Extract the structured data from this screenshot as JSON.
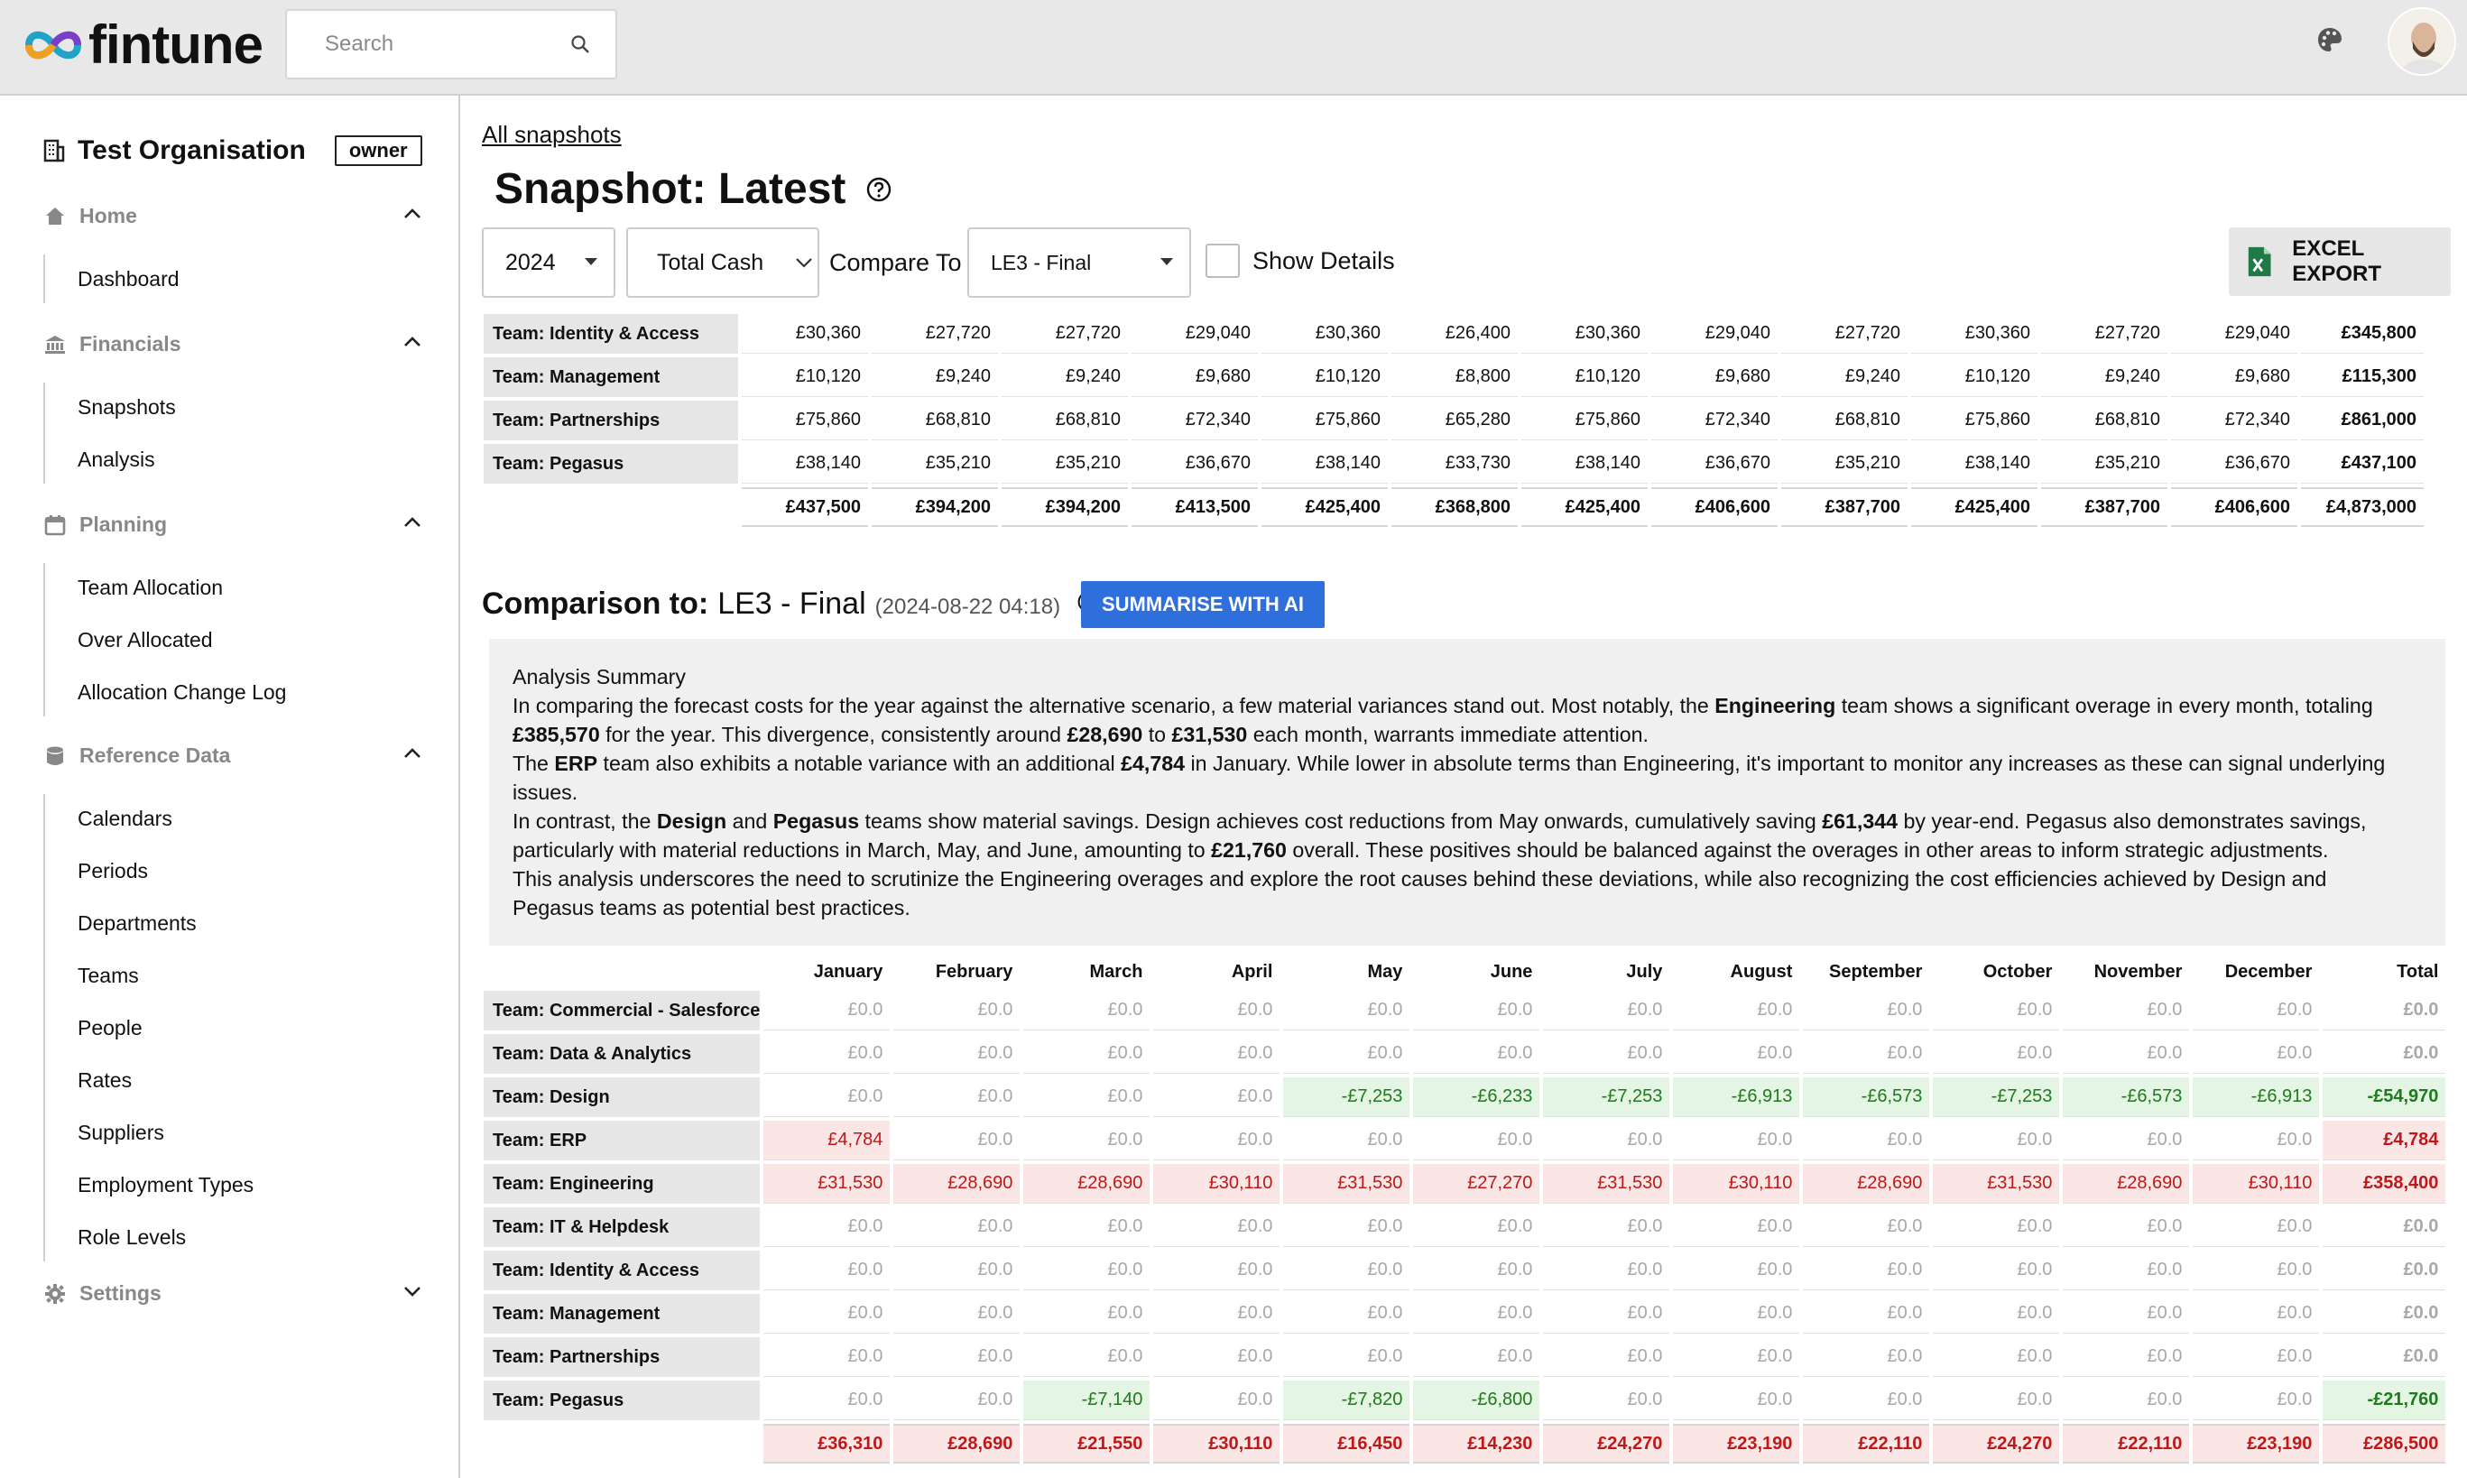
{
  "brand": {
    "name": "fintune"
  },
  "topbar": {
    "search_placeholder": "Search",
    "theme_icon": "palette-icon",
    "avatar": "user-avatar"
  },
  "sidebar": {
    "org_name": "Test Organisation",
    "role_badge": "owner",
    "sections": [
      {
        "key": "home",
        "label": "Home",
        "icon": "home-icon",
        "expanded": true,
        "items": [
          "Dashboard"
        ]
      },
      {
        "key": "financials",
        "label": "Financials",
        "icon": "bank-icon",
        "expanded": true,
        "items": [
          "Snapshots",
          "Analysis"
        ]
      },
      {
        "key": "planning",
        "label": "Planning",
        "icon": "calendar-icon",
        "expanded": true,
        "items": [
          "Team Allocation",
          "Over Allocated",
          "Allocation Change Log"
        ]
      },
      {
        "key": "reference",
        "label": "Reference Data",
        "icon": "database-icon",
        "expanded": true,
        "items": [
          "Calendars",
          "Periods",
          "Departments",
          "Teams",
          "People",
          "Rates",
          "Suppliers",
          "Employment Types",
          "Role Levels"
        ]
      },
      {
        "key": "settings",
        "label": "Settings",
        "icon": "gear-icon",
        "expanded": false,
        "items": []
      }
    ]
  },
  "page": {
    "breadcrumb": "All snapshots",
    "title": "Snapshot: Latest",
    "year": "2024",
    "metric": "Total Cash",
    "compare_label": "Compare To",
    "compare_value": "LE3 - Final",
    "show_details": "Show Details",
    "excel_export": "EXCEL EXPORT"
  },
  "snapshot_table": {
    "rows": [
      {
        "team": "Team: Identity & Access",
        "values": [
          "£30,360",
          "£27,720",
          "£27,720",
          "£29,040",
          "£30,360",
          "£26,400",
          "£30,360",
          "£29,040",
          "£27,720",
          "£30,360",
          "£27,720",
          "£29,040"
        ],
        "total": "£345,800"
      },
      {
        "team": "Team: Management",
        "values": [
          "£10,120",
          "£9,240",
          "£9,240",
          "£9,680",
          "£10,120",
          "£8,800",
          "£10,120",
          "£9,680",
          "£9,240",
          "£10,120",
          "£9,240",
          "£9,680"
        ],
        "total": "£115,300"
      },
      {
        "team": "Team: Partnerships",
        "values": [
          "£75,860",
          "£68,810",
          "£68,810",
          "£72,340",
          "£75,860",
          "£65,280",
          "£75,860",
          "£72,340",
          "£68,810",
          "£75,860",
          "£68,810",
          "£72,340"
        ],
        "total": "£861,000"
      },
      {
        "team": "Team: Pegasus",
        "values": [
          "£38,140",
          "£35,210",
          "£35,210",
          "£36,670",
          "£38,140",
          "£33,730",
          "£38,140",
          "£36,670",
          "£35,210",
          "£38,140",
          "£35,210",
          "£36,670"
        ],
        "total": "£437,100"
      }
    ],
    "totals": {
      "values": [
        "£437,500",
        "£394,200",
        "£394,200",
        "£413,500",
        "£425,400",
        "£368,800",
        "£425,400",
        "£406,600",
        "£387,700",
        "£425,400",
        "£387,700",
        "£406,600"
      ],
      "total": "£4,873,000"
    }
  },
  "comparison": {
    "prefix": "Comparison to:",
    "name": "LE3 - Final",
    "date": "(2024-08-22 04:18)",
    "ai_button": "SUMMARISE WITH AI",
    "summary_html": "Analysis Summary<br>In comparing the forecast costs for the year against the alternative scenario, a few material variances stand out. Most notably, the <b>Engineering</b> team shows a significant overage in every month, totaling<br><b>£385,570</b> for the year. This divergence, consistently around <b>£28,690</b> to <b>£31,530</b> each month, warrants immediate attention.<br>The <b>ERP</b> team also exhibits a notable variance with an additional <b>£4,784</b> in January. While lower in absolute terms than Engineering, it's important to monitor any increases as these can signal underlying<br>issues.<br>In contrast, the <b>Design</b> and <b>Pegasus</b> teams show material savings. Design achieves cost reductions from May onwards, cumulatively saving <b>£61,344</b> by year-end. Pegasus also demonstrates savings,<br>particularly with material reductions in March, May, and June, amounting to <b>£21,760</b> overall. These positives should be balanced against the overages in other areas to inform strategic adjustments.<br>This analysis underscores the need to scrutinize the Engineering overages and explore the root causes behind these deviations, while also recognizing the cost efficiencies achieved by Design and<br>Pegasus teams as potential best practices."
  },
  "comparison_table": {
    "months": [
      "January",
      "February",
      "March",
      "April",
      "May",
      "June",
      "July",
      "August",
      "September",
      "October",
      "November",
      "December"
    ],
    "total_header": "Total",
    "rows": [
      {
        "team": "Team: Commercial - Salesforce",
        "values": [
          "£0.0",
          "£0.0",
          "£0.0",
          "£0.0",
          "£0.0",
          "£0.0",
          "£0.0",
          "£0.0",
          "£0.0",
          "£0.0",
          "£0.0",
          "£0.0"
        ],
        "total": "£0.0"
      },
      {
        "team": "Team: Data & Analytics",
        "values": [
          "£0.0",
          "£0.0",
          "£0.0",
          "£0.0",
          "£0.0",
          "£0.0",
          "£0.0",
          "£0.0",
          "£0.0",
          "£0.0",
          "£0.0",
          "£0.0"
        ],
        "total": "£0.0"
      },
      {
        "team": "Team: Design",
        "values": [
          "£0.0",
          "£0.0",
          "£0.0",
          "£0.0",
          "-£7,253",
          "-£6,233",
          "-£7,253",
          "-£6,913",
          "-£6,573",
          "-£7,253",
          "-£6,573",
          "-£6,913"
        ],
        "total": "-£54,970"
      },
      {
        "team": "Team: ERP",
        "values": [
          "£4,784",
          "£0.0",
          "£0.0",
          "£0.0",
          "£0.0",
          "£0.0",
          "£0.0",
          "£0.0",
          "£0.0",
          "£0.0",
          "£0.0",
          "£0.0"
        ],
        "total": "£4,784"
      },
      {
        "team": "Team: Engineering",
        "values": [
          "£31,530",
          "£28,690",
          "£28,690",
          "£30,110",
          "£31,530",
          "£27,270",
          "£31,530",
          "£30,110",
          "£28,690",
          "£31,530",
          "£28,690",
          "£30,110"
        ],
        "total": "£358,400"
      },
      {
        "team": "Team: IT & Helpdesk",
        "values": [
          "£0.0",
          "£0.0",
          "£0.0",
          "£0.0",
          "£0.0",
          "£0.0",
          "£0.0",
          "£0.0",
          "£0.0",
          "£0.0",
          "£0.0",
          "£0.0"
        ],
        "total": "£0.0"
      },
      {
        "team": "Team: Identity & Access",
        "values": [
          "£0.0",
          "£0.0",
          "£0.0",
          "£0.0",
          "£0.0",
          "£0.0",
          "£0.0",
          "£0.0",
          "£0.0",
          "£0.0",
          "£0.0",
          "£0.0"
        ],
        "total": "£0.0"
      },
      {
        "team": "Team: Management",
        "values": [
          "£0.0",
          "£0.0",
          "£0.0",
          "£0.0",
          "£0.0",
          "£0.0",
          "£0.0",
          "£0.0",
          "£0.0",
          "£0.0",
          "£0.0",
          "£0.0"
        ],
        "total": "£0.0"
      },
      {
        "team": "Team: Partnerships",
        "values": [
          "£0.0",
          "£0.0",
          "£0.0",
          "£0.0",
          "£0.0",
          "£0.0",
          "£0.0",
          "£0.0",
          "£0.0",
          "£0.0",
          "£0.0",
          "£0.0"
        ],
        "total": "£0.0"
      },
      {
        "team": "Team: Pegasus",
        "values": [
          "£0.0",
          "£0.0",
          "-£7,140",
          "£0.0",
          "-£7,820",
          "-£6,800",
          "£0.0",
          "£0.0",
          "£0.0",
          "£0.0",
          "£0.0",
          "£0.0"
        ],
        "total": "-£21,760"
      }
    ],
    "totals": {
      "values": [
        "£36,310",
        "£28,690",
        "£21,550",
        "£30,110",
        "£16,450",
        "£14,230",
        "£24,270",
        "£23,190",
        "£22,110",
        "£24,270",
        "£22,110",
        "£23,190"
      ],
      "total": "£286,500"
    }
  },
  "colors": {
    "accent_blue": "#2f6fdb",
    "variance_over": "#c01818",
    "variance_under": "#1e7a1e",
    "zero": "#a8a8a8"
  }
}
